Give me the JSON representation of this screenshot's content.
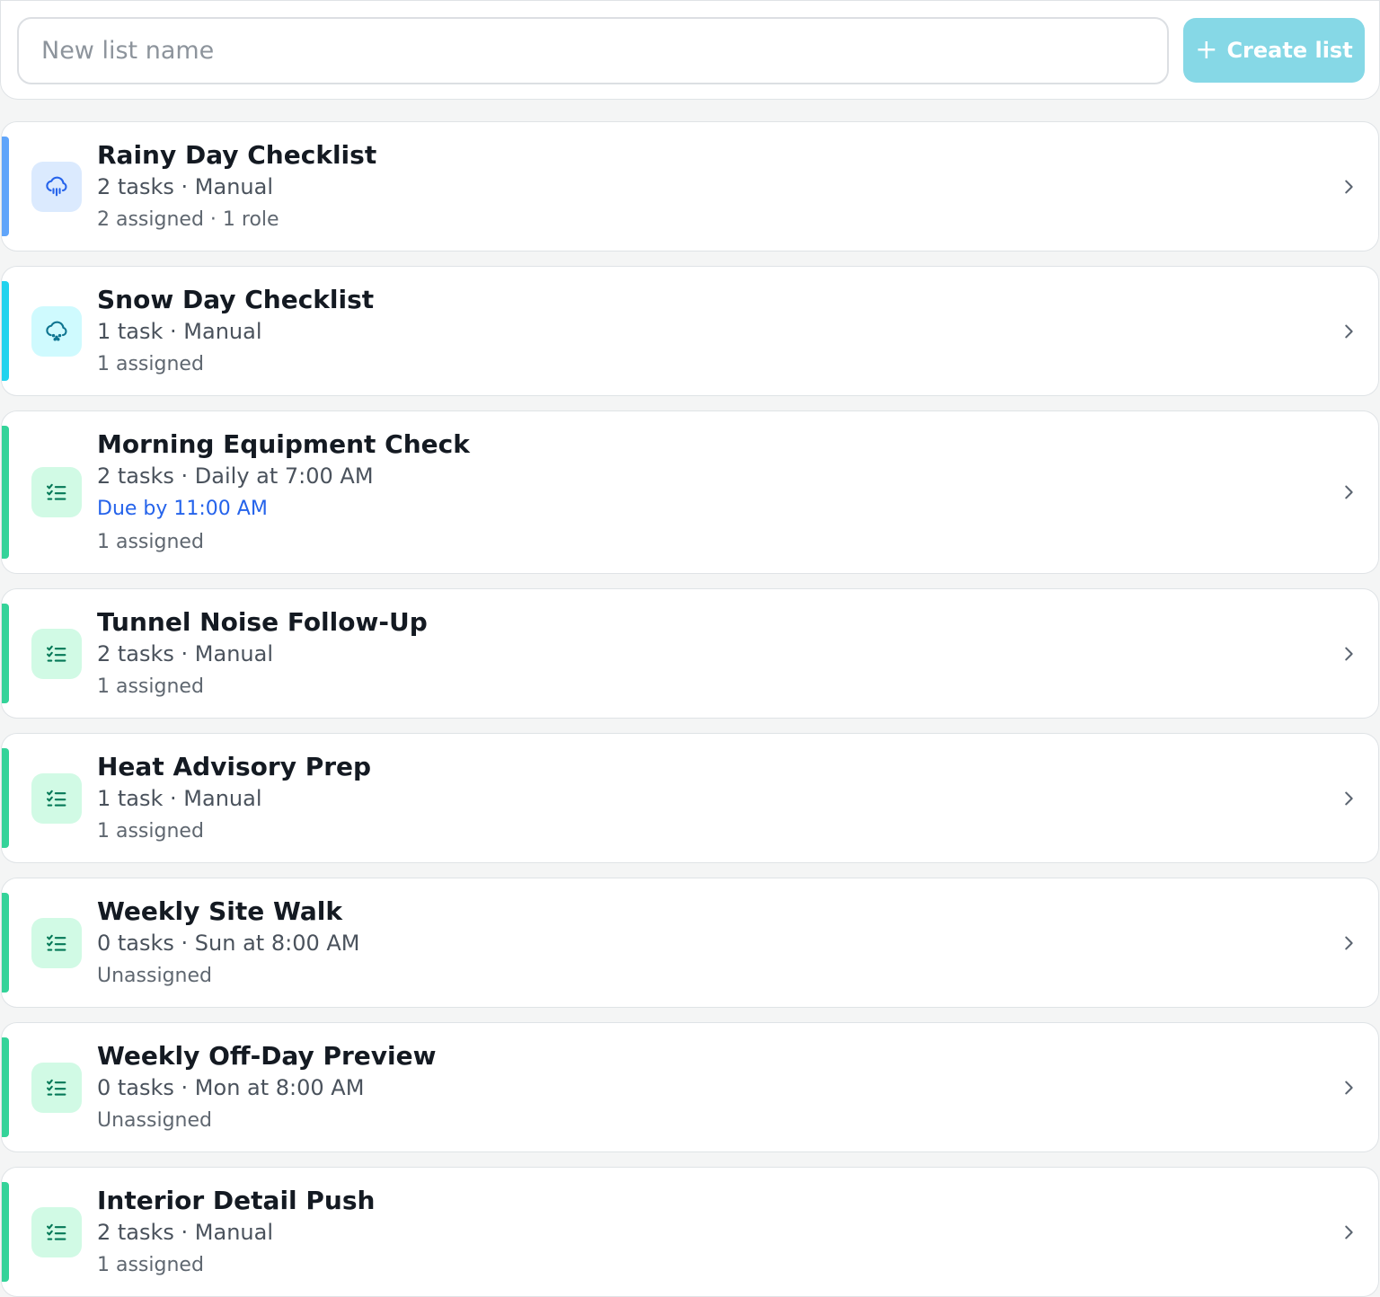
{
  "create": {
    "placeholder": "New list name",
    "button_label": "Create list"
  },
  "lists": [
    {
      "title": "Rainy Day Checklist",
      "meta": "2 tasks · Manual",
      "due": "",
      "assigned": "2 assigned · 1 role",
      "icon": "rain-cloud-icon",
      "accent": "#60a5fa",
      "icon_bg": "#dbeafe",
      "icon_color": "#2563eb"
    },
    {
      "title": "Snow Day Checklist",
      "meta": "1 task · Manual",
      "due": "",
      "assigned": "1 assigned",
      "icon": "snow-cloud-icon",
      "accent": "#22d3ee",
      "icon_bg": "#cffafe",
      "icon_color": "#0e7490"
    },
    {
      "title": "Morning Equipment Check",
      "meta": "2 tasks · Daily at 7:00 AM",
      "due": "Due by 11:00 AM",
      "assigned": "1 assigned",
      "icon": "checklist-icon",
      "accent": "#34d399",
      "icon_bg": "#d1fae5",
      "icon_color": "#047857"
    },
    {
      "title": "Tunnel Noise Follow-Up",
      "meta": "2 tasks · Manual",
      "due": "",
      "assigned": "1 assigned",
      "icon": "checklist-icon",
      "accent": "#34d399",
      "icon_bg": "#d1fae5",
      "icon_color": "#047857"
    },
    {
      "title": "Heat Advisory Prep",
      "meta": "1 task · Manual",
      "due": "",
      "assigned": "1 assigned",
      "icon": "checklist-icon",
      "accent": "#34d399",
      "icon_bg": "#d1fae5",
      "icon_color": "#047857"
    },
    {
      "title": "Weekly Site Walk",
      "meta": "0 tasks · Sun at 8:00 AM",
      "due": "",
      "assigned": "Unassigned",
      "icon": "checklist-icon",
      "accent": "#34d399",
      "icon_bg": "#d1fae5",
      "icon_color": "#047857"
    },
    {
      "title": "Weekly Off-Day Preview",
      "meta": "0 tasks · Mon at 8:00 AM",
      "due": "",
      "assigned": "Unassigned",
      "icon": "checklist-icon",
      "accent": "#34d399",
      "icon_bg": "#d1fae5",
      "icon_color": "#047857"
    },
    {
      "title": "Interior Detail Push",
      "meta": "2 tasks · Manual",
      "due": "",
      "assigned": "1 assigned",
      "icon": "checklist-icon",
      "accent": "#34d399",
      "icon_bg": "#d1fae5",
      "icon_color": "#047857"
    }
  ]
}
